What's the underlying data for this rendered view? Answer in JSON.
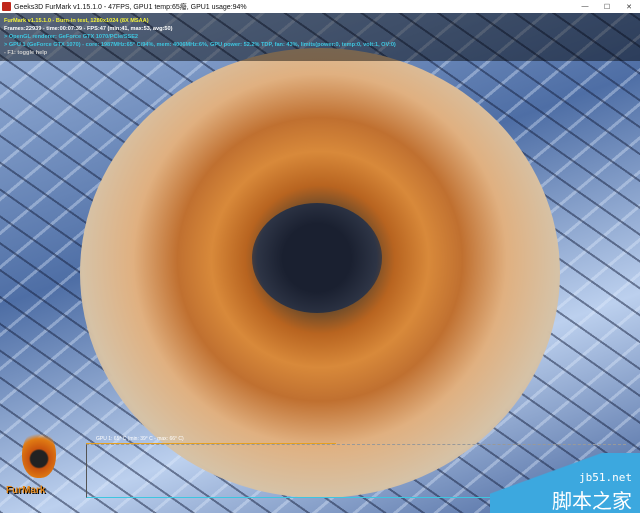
{
  "window": {
    "title": "Geeks3D FurMark v1.15.1.0 - 47FPS, GPU1 temp:65癈, GPU1 usage:94%",
    "controls": [
      "minimize",
      "maximize",
      "close"
    ]
  },
  "osd": {
    "line1": "FurMark v1.15.1.0 - Burn-in test, 1280x1024 (8X MSAA)",
    "line2": "Frames:22939 - time:00:07:39 - FPS:47 (min:41, max:53, avg:50)",
    "line3": "> OpenGL renderer: GeForce GTX 1070/PCIe/SSE2",
    "line4": "> GPU 1 (GeForce GTX 1070) - core: 1987MHz:65° C/94%, mem: 4006MHz:6%, GPU power: 52.2% TDP, fan: 43%, limits(power:0, temp:0, volt:1, OV:0)",
    "line5": "- F1: toggle help"
  },
  "graph": {
    "label": "GPU 1: 65° C (min: 39° C - max: 66° C)",
    "color": "#e6a020"
  },
  "logo": {
    "text": "FurMark"
  },
  "watermark": {
    "url": "jb51.net",
    "name": "脚本之家",
    "color": "#3ca8df"
  }
}
